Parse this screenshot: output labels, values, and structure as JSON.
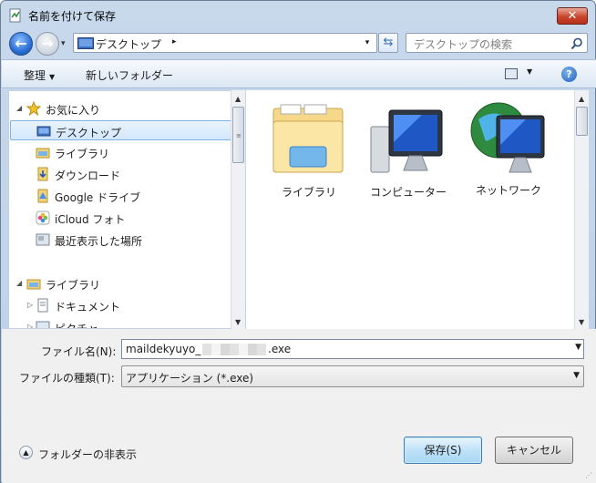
{
  "window": {
    "title": "名前を付けて保存",
    "close_symbol": "✕"
  },
  "address_bar": {
    "location": "デスクトップ",
    "separator": "▸",
    "dropdown": "▾"
  },
  "search": {
    "placeholder": "デスクトップの検索"
  },
  "toolbar": {
    "organize": "整理",
    "new_folder": "新しいフォルダー",
    "help": "?"
  },
  "navigation": {
    "favorites": {
      "label": "お気に入り",
      "items": [
        {
          "label": "デスクトップ",
          "icon": "desktop-icon",
          "selected": true
        },
        {
          "label": "ライブラリ",
          "icon": "library-icon"
        },
        {
          "label": "ダウンロード",
          "icon": "download-folder-icon"
        },
        {
          "label": "Google ドライブ",
          "icon": "google-drive-icon"
        },
        {
          "label": "iCloud フォト",
          "icon": "icloud-photos-icon"
        },
        {
          "label": "最近表示した場所",
          "icon": "recent-places-icon"
        }
      ]
    },
    "libraries": {
      "label": "ライブラリ",
      "items": [
        {
          "label": "ドキュメント",
          "icon": "documents-icon"
        },
        {
          "label": "ピクチャ",
          "icon": "pictures-icon"
        }
      ]
    }
  },
  "content_items": [
    {
      "label": "ライブラリ",
      "icon": "library-folder-icon"
    },
    {
      "label": "コンピューター",
      "icon": "computer-icon"
    },
    {
      "label": "ネットワーク",
      "icon": "network-icon"
    }
  ],
  "form": {
    "filename_label": "ファイル名(N):",
    "filename_value_prefix": "maildekyuyo_",
    "filename_value_suffix": ".exe",
    "filetype_label": "ファイルの種類(T):",
    "filetype_value": "アプリケーション (*.exe)"
  },
  "footer": {
    "hide_folders": "フォルダーの非表示",
    "save_button": "保存(S)",
    "cancel_button": "キャンセル"
  }
}
